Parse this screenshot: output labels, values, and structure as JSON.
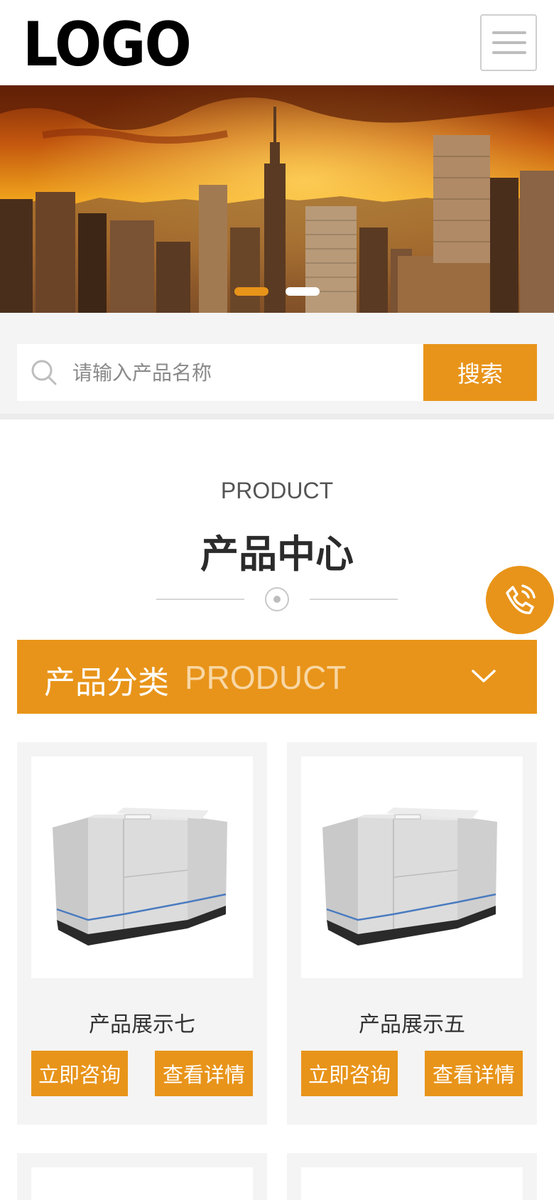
{
  "header": {
    "logo_text": "LOGO",
    "menu_icon": "hamburger-menu-icon"
  },
  "banner": {
    "slides_total": 2,
    "active_slide": 1
  },
  "search": {
    "placeholder": "请输入产品名称",
    "button_label": "搜索"
  },
  "product_section": {
    "title_en": "PRODUCT",
    "title_cn": "产品中心"
  },
  "category_bar": {
    "label_cn": "产品分类",
    "label_en": "PRODUCT"
  },
  "products": [
    {
      "name": "产品展示七",
      "consult_label": "立即咨询",
      "detail_label": "查看详情"
    },
    {
      "name": "产品展示五",
      "consult_label": "立即咨询",
      "detail_label": "查看详情"
    }
  ],
  "colors": {
    "accent": "#e8941a",
    "background_gray": "#f4f4f4"
  },
  "floating": {
    "phone_icon": "phone-call-icon"
  }
}
